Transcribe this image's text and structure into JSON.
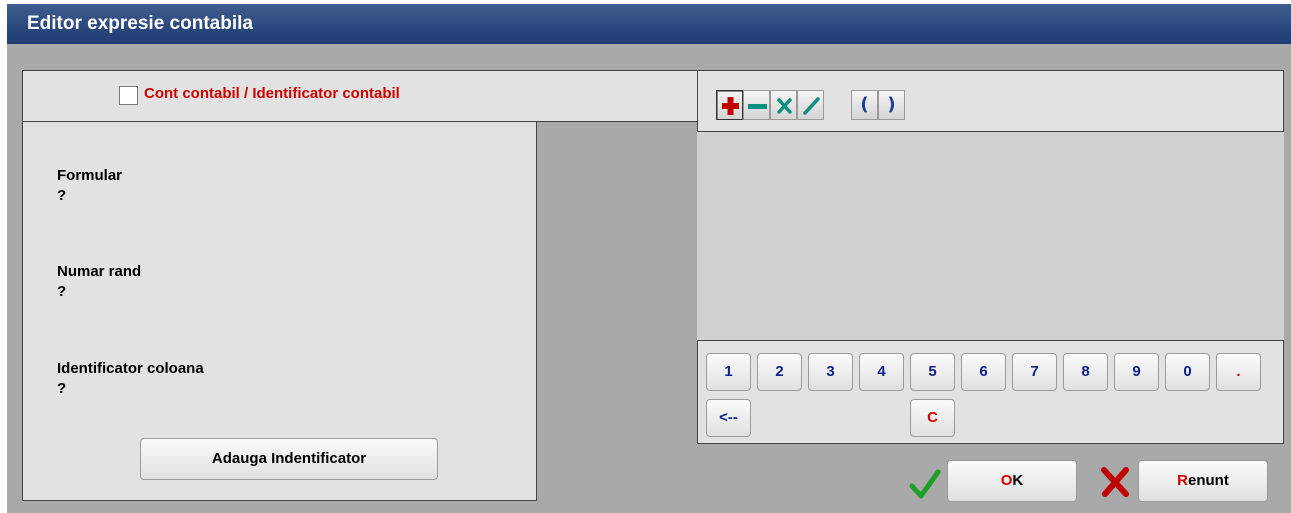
{
  "window": {
    "title": "Editor expresie contabila"
  },
  "account_checkbox": {
    "label": "Cont contabil / Identificator contabil",
    "checked": false
  },
  "fields": [
    {
      "label": "Formular",
      "value": "?"
    },
    {
      "label": "Numar rand",
      "value": "?"
    },
    {
      "label": "Identificator coloana",
      "value": "?"
    }
  ],
  "add_button": {
    "label": "Adauga Indentificator"
  },
  "operators": {
    "plus": "plus-icon",
    "minus": "minus-icon",
    "multiply": "multiply-icon",
    "divide": "divide-icon",
    "open_paren": "(",
    "close_paren": ")"
  },
  "keypad": {
    "digits": [
      "1",
      "2",
      "3",
      "4",
      "5",
      "6",
      "7",
      "8",
      "9",
      "0",
      "."
    ],
    "backspace": "<--",
    "clear": "C"
  },
  "ok_button": {
    "mnemonic": "O",
    "rest": "K"
  },
  "cancel_button": {
    "mnemonic": "R",
    "rest": "enunt"
  },
  "colors": {
    "title_bar": "#1e3b73",
    "accent_red": "#d00000",
    "key_text": "#11218a",
    "op_green": "#0e8f7f"
  }
}
